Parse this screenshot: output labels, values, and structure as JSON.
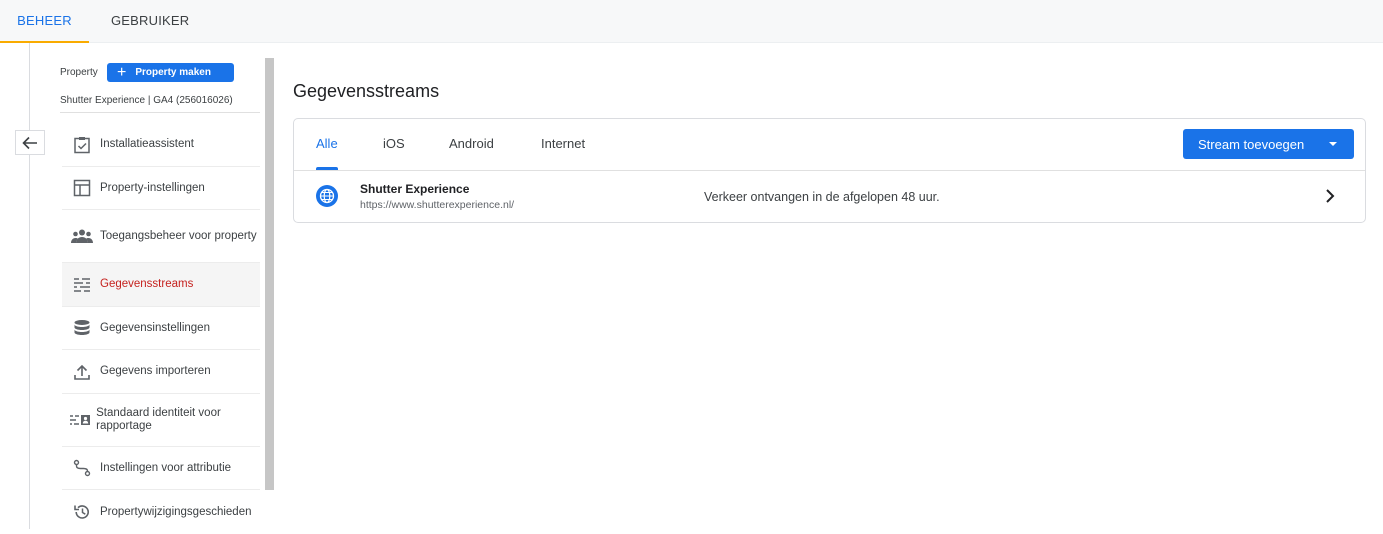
{
  "top_tabs": {
    "beheer": "BEHEER",
    "gebruiker": "GEBRUIKER"
  },
  "property": {
    "label": "Property",
    "create_button": "Property maken",
    "name": "Shutter Experience | GA4 (256016026)"
  },
  "menu": {
    "items": [
      {
        "label": "Installatieassistent",
        "icon": "checklist-icon"
      },
      {
        "label": "Property-instellingen",
        "icon": "layout-icon"
      },
      {
        "label": "Toegangsbeheer voor property",
        "icon": "people-icon"
      },
      {
        "label": "Gegevensstreams",
        "icon": "streams-icon",
        "active": true
      },
      {
        "label": "Gegevensinstellingen",
        "icon": "database-icon"
      },
      {
        "label": "Gegevens importeren",
        "icon": "upload-icon"
      },
      {
        "label": "Standaard identiteit voor rapportage",
        "icon": "identity-icon"
      },
      {
        "label": "Instellingen voor attributie",
        "icon": "attribution-icon"
      },
      {
        "label": "Propertywijzigingsgeschieden",
        "icon": "history-icon"
      }
    ]
  },
  "main": {
    "title": "Gegevensstreams",
    "tabs": [
      "Alle",
      "iOS",
      "Android",
      "Internet"
    ],
    "add_button": "Stream toevoegen",
    "streams": [
      {
        "name": "Shutter Experience",
        "url": "https://www.shutterexperience.nl/",
        "status": "Verkeer ontvangen in de afgelopen 48 uur."
      }
    ]
  },
  "colors": {
    "accent": "#1a73e8",
    "active_menu_text": "#c5221f",
    "top_tab_indicator": "#f9ab00"
  }
}
